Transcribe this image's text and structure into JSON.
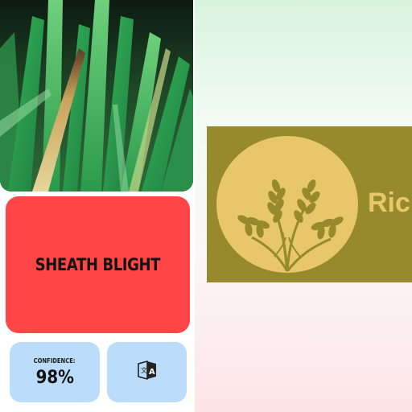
{
  "result": {
    "disease_name": "SHEATH BLIGHT",
    "confidence_label": "CONFIDENCE:",
    "confidence_value": "98%"
  },
  "actions": {
    "translate_icon": "translate-icon"
  },
  "banner": {
    "logo_icon": "rice-plant-icon",
    "brand_text": "Ric"
  },
  "colors": {
    "diagnosis_card": "#ff4545",
    "info_cards": "#bbdcfa",
    "banner_background": "#978a2c",
    "logo_accent": "#e8c76a"
  }
}
